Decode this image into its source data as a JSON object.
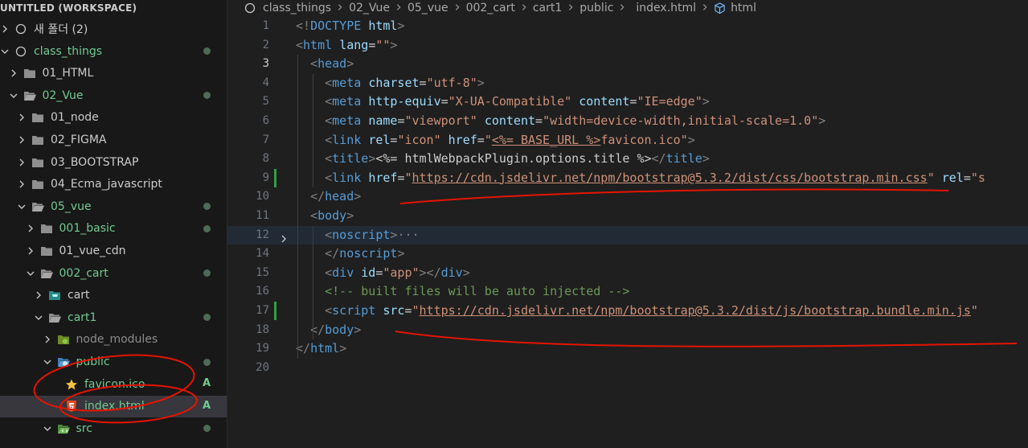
{
  "sidebar": {
    "title": "UNTITLED (WORKSPACE)",
    "items": [
      {
        "label": "새 폴더 (2)",
        "depth": 0,
        "expanded": false,
        "icon": "workspace-folder-icon",
        "color": "normal",
        "dot": false
      },
      {
        "label": "class_things",
        "depth": 0,
        "expanded": true,
        "icon": "workspace-folder-icon",
        "color": "green",
        "dot": true
      },
      {
        "label": "01_HTML",
        "depth": 1,
        "expanded": false,
        "icon": "folder-icon",
        "color": "normal",
        "dot": false
      },
      {
        "label": "02_Vue",
        "depth": 1,
        "expanded": true,
        "icon": "folder-open-icon",
        "color": "green",
        "dot": true
      },
      {
        "label": "01_node",
        "depth": 2,
        "expanded": false,
        "icon": "folder-icon",
        "color": "normal",
        "dot": false
      },
      {
        "label": "02_FIGMA",
        "depth": 2,
        "expanded": false,
        "icon": "folder-icon",
        "color": "normal",
        "dot": false
      },
      {
        "label": "03_BOOTSTRAP",
        "depth": 2,
        "expanded": false,
        "icon": "folder-icon",
        "color": "normal",
        "dot": false
      },
      {
        "label": "04_Ecma_javascript",
        "depth": 2,
        "expanded": false,
        "icon": "folder-icon",
        "color": "normal",
        "dot": false
      },
      {
        "label": "05_vue",
        "depth": 2,
        "expanded": true,
        "icon": "folder-open-icon",
        "color": "green",
        "dot": true
      },
      {
        "label": "001_basic",
        "depth": 3,
        "expanded": false,
        "icon": "folder-icon",
        "color": "green",
        "dot": true
      },
      {
        "label": "01_vue_cdn",
        "depth": 3,
        "expanded": false,
        "icon": "folder-icon",
        "color": "normal",
        "dot": false
      },
      {
        "label": "002_cart",
        "depth": 3,
        "expanded": true,
        "icon": "folder-open-icon",
        "color": "green",
        "dot": true
      },
      {
        "label": "cart",
        "depth": 4,
        "expanded": false,
        "icon": "cart-folder-icon",
        "color": "normal",
        "dot": false
      },
      {
        "label": "cart1",
        "depth": 4,
        "expanded": true,
        "icon": "folder-open-icon",
        "color": "green",
        "dot": true
      },
      {
        "label": "node_modules",
        "depth": 5,
        "expanded": false,
        "icon": "node-modules-folder-icon",
        "color": "dim",
        "dot": false
      },
      {
        "label": "public",
        "depth": 5,
        "expanded": true,
        "icon": "public-folder-icon",
        "color": "green",
        "dot": true
      },
      {
        "label": "favicon.ico",
        "depth": 6,
        "expanded": null,
        "icon": "star-icon",
        "color": "green",
        "badge": "A"
      },
      {
        "label": "index.html",
        "depth": 6,
        "expanded": null,
        "icon": "html5-icon",
        "color": "green",
        "badge": "A",
        "selected": true
      },
      {
        "label": "src",
        "depth": 5,
        "expanded": true,
        "icon": "src-folder-icon",
        "color": "green",
        "dot": true
      }
    ]
  },
  "breadcrumb": [
    "class_things",
    "02_Vue",
    "05_vue",
    "002_cart",
    "cart1",
    "public",
    "index.html",
    "html"
  ],
  "editor": {
    "active_line": 3,
    "lines": [
      {
        "n": "1",
        "tokens": [
          [
            "t",
            "<!"
          ],
          [
            "tag",
            "DOCTYPE"
          ],
          [
            "txt",
            " "
          ],
          [
            "attr",
            "html"
          ],
          [
            "t",
            ">"
          ]
        ]
      },
      {
        "n": "2",
        "tokens": [
          [
            "t",
            "<"
          ],
          [
            "tag",
            "html"
          ],
          [
            "txt",
            " "
          ],
          [
            "attr",
            "lang"
          ],
          [
            "txt",
            "="
          ],
          [
            "str",
            "\"\""
          ],
          [
            "t",
            ">"
          ]
        ]
      },
      {
        "n": "3",
        "tokens": [
          [
            "txt",
            "  "
          ],
          [
            "t",
            "<"
          ],
          [
            "tag",
            "head"
          ],
          [
            "t",
            ">"
          ]
        ]
      },
      {
        "n": "4",
        "tokens": [
          [
            "txt",
            "    "
          ],
          [
            "t",
            "<"
          ],
          [
            "tag",
            "meta"
          ],
          [
            "txt",
            " "
          ],
          [
            "attr",
            "charset"
          ],
          [
            "txt",
            "="
          ],
          [
            "str",
            "\"utf-8\""
          ],
          [
            "t",
            ">"
          ]
        ]
      },
      {
        "n": "5",
        "tokens": [
          [
            "txt",
            "    "
          ],
          [
            "t",
            "<"
          ],
          [
            "tag",
            "meta"
          ],
          [
            "txt",
            " "
          ],
          [
            "attr",
            "http-equiv"
          ],
          [
            "txt",
            "="
          ],
          [
            "str",
            "\"X-UA-Compatible\""
          ],
          [
            "txt",
            " "
          ],
          [
            "attr",
            "content"
          ],
          [
            "txt",
            "="
          ],
          [
            "str",
            "\"IE=edge\""
          ],
          [
            "t",
            ">"
          ]
        ]
      },
      {
        "n": "6",
        "tokens": [
          [
            "txt",
            "    "
          ],
          [
            "t",
            "<"
          ],
          [
            "tag",
            "meta"
          ],
          [
            "txt",
            " "
          ],
          [
            "attr",
            "name"
          ],
          [
            "txt",
            "="
          ],
          [
            "str",
            "\"viewport\""
          ],
          [
            "txt",
            " "
          ],
          [
            "attr",
            "content"
          ],
          [
            "txt",
            "="
          ],
          [
            "str",
            "\"width=device-width,initial-scale=1.0\""
          ],
          [
            "t",
            ">"
          ]
        ]
      },
      {
        "n": "7",
        "tokens": [
          [
            "txt",
            "    "
          ],
          [
            "t",
            "<"
          ],
          [
            "tag",
            "link"
          ],
          [
            "txt",
            " "
          ],
          [
            "attr",
            "rel"
          ],
          [
            "txt",
            "="
          ],
          [
            "str",
            "\"icon\""
          ],
          [
            "txt",
            " "
          ],
          [
            "attr",
            "href"
          ],
          [
            "txt",
            "="
          ],
          [
            "str",
            "\""
          ],
          [
            "url",
            "<%= BASE_URL %>"
          ],
          [
            "str",
            "favicon.ico\""
          ],
          [
            "t",
            ">"
          ]
        ]
      },
      {
        "n": "8",
        "tokens": [
          [
            "txt",
            "    "
          ],
          [
            "t",
            "<"
          ],
          [
            "tag",
            "title"
          ],
          [
            "t",
            ">"
          ],
          [
            "txt",
            "<%= htmlWebpackPlugin.options.title %>"
          ],
          [
            "t",
            "</"
          ],
          [
            "tag",
            "title"
          ],
          [
            "t",
            ">"
          ]
        ]
      },
      {
        "n": "9",
        "tokens": [
          [
            "txt",
            "    "
          ],
          [
            "t",
            "<"
          ],
          [
            "tag",
            "link"
          ],
          [
            "txt",
            " "
          ],
          [
            "attr",
            "href"
          ],
          [
            "txt",
            "="
          ],
          [
            "str",
            "\""
          ],
          [
            "url",
            "https://cdn.jsdelivr.net/npm/bootstrap@5.3.2/dist/css/bootstrap.min.css"
          ],
          [
            "str",
            "\""
          ],
          [
            "txt",
            " "
          ],
          [
            "attr",
            "rel"
          ],
          [
            "txt",
            "="
          ],
          [
            "str",
            "\"s"
          ]
        ]
      },
      {
        "n": "10",
        "tokens": [
          [
            "txt",
            "  "
          ],
          [
            "t",
            "</"
          ],
          [
            "tag",
            "head"
          ],
          [
            "t",
            ">"
          ]
        ]
      },
      {
        "n": "11",
        "tokens": [
          [
            "txt",
            "  "
          ],
          [
            "t",
            "<"
          ],
          [
            "tag",
            "body"
          ],
          [
            "t",
            ">"
          ]
        ]
      },
      {
        "n": "12",
        "tokens": [
          [
            "txt",
            "    "
          ],
          [
            "t",
            "<"
          ],
          [
            "tag",
            "noscript"
          ],
          [
            "t",
            ">"
          ],
          [
            "t",
            "···"
          ]
        ]
      },
      {
        "n": "14",
        "tokens": [
          [
            "txt",
            "    "
          ],
          [
            "t",
            "</"
          ],
          [
            "tag",
            "noscript"
          ],
          [
            "t",
            ">"
          ]
        ]
      },
      {
        "n": "15",
        "tokens": [
          [
            "txt",
            "    "
          ],
          [
            "t",
            "<"
          ],
          [
            "tag",
            "div"
          ],
          [
            "txt",
            " "
          ],
          [
            "attr",
            "id"
          ],
          [
            "txt",
            "="
          ],
          [
            "str",
            "\"app\""
          ],
          [
            "t",
            "></"
          ],
          [
            "tag",
            "div"
          ],
          [
            "t",
            ">"
          ]
        ]
      },
      {
        "n": "16",
        "tokens": [
          [
            "txt",
            "    "
          ],
          [
            "cm",
            "<!-- built files will be auto injected -->"
          ]
        ]
      },
      {
        "n": "17",
        "tokens": [
          [
            "txt",
            "    "
          ],
          [
            "t",
            "<"
          ],
          [
            "tag",
            "script"
          ],
          [
            "txt",
            " "
          ],
          [
            "attr",
            "src"
          ],
          [
            "txt",
            "="
          ],
          [
            "str",
            "\""
          ],
          [
            "url",
            "https://cdn.jsdelivr.net/npm/bootstrap@5.3.2/dist/js/bootstrap.bundle.min.js"
          ],
          [
            "str",
            "\""
          ]
        ]
      },
      {
        "n": "18",
        "tokens": [
          [
            "txt",
            "  "
          ],
          [
            "t",
            "</"
          ],
          [
            "tag",
            "body"
          ],
          [
            "t",
            ">"
          ]
        ]
      },
      {
        "n": "19",
        "tokens": [
          [
            "t",
            "</"
          ],
          [
            "tag",
            "html"
          ],
          [
            "t",
            ">"
          ]
        ]
      },
      {
        "n": "20",
        "tokens": []
      }
    ]
  },
  "colors": {
    "accent": "#e51400",
    "tag": "#569cd6",
    "attr": "#9cdcfe",
    "string": "#ce9178",
    "comment": "#6a9955",
    "git_added": "#73c991"
  }
}
